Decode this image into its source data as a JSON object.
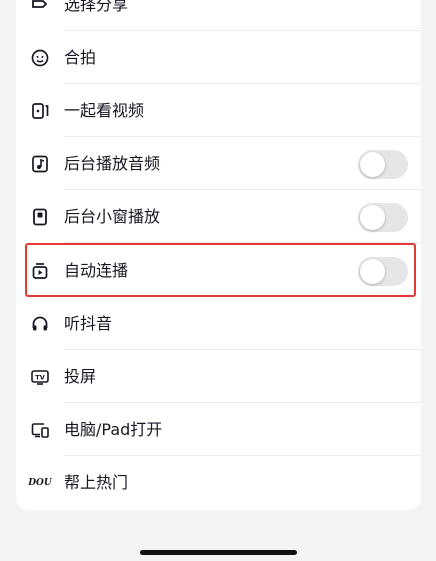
{
  "menu": {
    "items": [
      {
        "id": "partial",
        "label": "选择分享",
        "icon": "share-icon",
        "has_toggle": false
      },
      {
        "id": "duet",
        "label": "合拍",
        "icon": "duet-icon",
        "has_toggle": false
      },
      {
        "id": "watch-together",
        "label": "一起看视频",
        "icon": "watch-together-icon",
        "has_toggle": false
      },
      {
        "id": "bg-audio",
        "label": "后台播放音频",
        "icon": "background-audio-icon",
        "has_toggle": true,
        "toggle_on": false
      },
      {
        "id": "mini-window",
        "label": "后台小窗播放",
        "icon": "mini-window-icon",
        "has_toggle": true,
        "toggle_on": false
      },
      {
        "id": "autoplay",
        "label": "自动连播",
        "icon": "autoplay-icon",
        "has_toggle": true,
        "toggle_on": false,
        "highlighted": true
      },
      {
        "id": "listen",
        "label": "听抖音",
        "icon": "headphones-icon",
        "has_toggle": false
      },
      {
        "id": "cast",
        "label": "投屏",
        "icon": "tv-icon",
        "has_toggle": false
      },
      {
        "id": "pc-pad",
        "label": "电脑/Pad打开",
        "icon": "computer-pad-icon",
        "has_toggle": false
      },
      {
        "id": "dou",
        "label": "帮上热门",
        "icon": "dou-plus-icon",
        "icon_text": "DOU",
        "has_toggle": false
      }
    ]
  },
  "colors": {
    "highlight": "#e53935",
    "toggle_off": "#e6e6e8",
    "text": "#161823"
  }
}
